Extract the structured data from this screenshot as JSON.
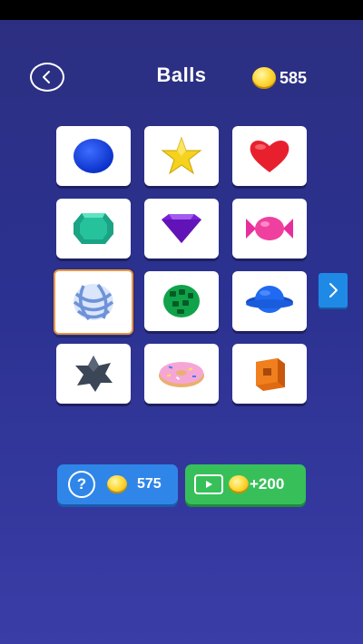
{
  "header": {
    "title": "Balls",
    "coins": "585",
    "back_icon": "chevron-left-icon",
    "coin_icon": "coin-icon"
  },
  "grid": {
    "items": [
      {
        "name": "blue-ball"
      },
      {
        "name": "yellow-star"
      },
      {
        "name": "red-heart"
      },
      {
        "name": "green-gem"
      },
      {
        "name": "purple-diamond"
      },
      {
        "name": "pink-candy"
      },
      {
        "name": "striped-sphere",
        "selected": true
      },
      {
        "name": "green-cage-ball"
      },
      {
        "name": "blue-saturn"
      },
      {
        "name": "dark-spiky-rock"
      },
      {
        "name": "pink-donut"
      },
      {
        "name": "orange-box"
      }
    ],
    "next_icon": "chevron-right-icon"
  },
  "actions": {
    "unlock_cost": "575",
    "reward": "+200",
    "unlock_icon": "question-icon",
    "reward_icon": "video-play-icon"
  },
  "colors": {
    "bg_top": "#2c2f80",
    "bg_bottom": "#3a3da6",
    "unlock_button": "#2f86e8",
    "reward_button": "#37c05a",
    "selected_border": "#e8964a",
    "coin": "#ffd83a"
  }
}
